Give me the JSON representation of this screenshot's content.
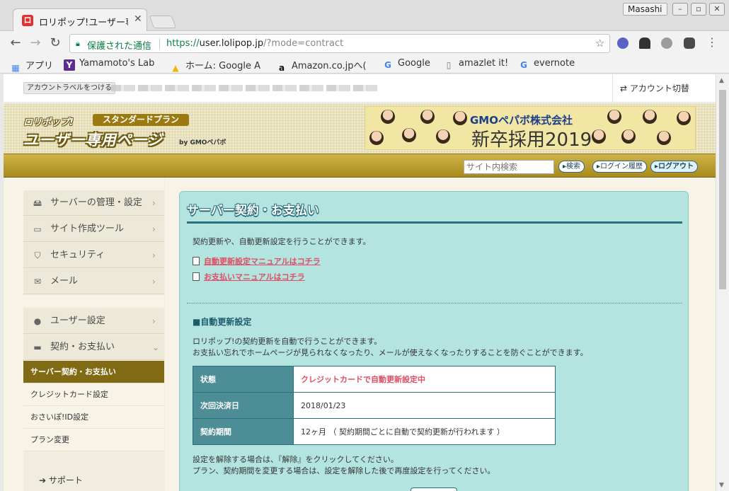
{
  "browser": {
    "tab_title": "ロリポップ!ユーザー専用ページ",
    "profile_name": "Masashi",
    "secure_label": "保護された通信",
    "url_scheme": "https://",
    "url_host": "user.lolipop.jp",
    "url_path": "/?mode=contract",
    "bookmarks": [
      {
        "label": "アプリ",
        "icon": "apps-grid-icon"
      },
      {
        "label": "Yamamoto's Lab",
        "icon": "yahoo-y-icon"
      },
      {
        "label": "ホーム: Google A",
        "icon": "google-drive-icon"
      },
      {
        "label": "Amazon.co.jpへ(",
        "icon": "amazon-icon"
      },
      {
        "label": "Google",
        "icon": "google-g-icon"
      },
      {
        "label": "amazlet it!",
        "icon": "page-icon"
      },
      {
        "label": "evernote",
        "icon": "google-g-icon"
      }
    ]
  },
  "account_bar": {
    "label_button": "アカウントラベルをつける",
    "switch_label": "アカウント切替"
  },
  "header": {
    "logo_top": "ロリポップ!",
    "plan_badge": "スタンダードプラン",
    "logo_main": "ユーザー専用ページ",
    "logo_by": "by GMOペパボ",
    "banner_company": "GMOペパボ株式会社",
    "banner_recruit": "新卒採用2019"
  },
  "nav": {
    "search_placeholder": "サイト内検索",
    "search_button": "▸検索",
    "login_history": "▸ログイン履歴",
    "logout": "▸ログアウト"
  },
  "sidebar": {
    "groups": [
      {
        "label": "サーバーの管理・設定",
        "icon": "server-icon"
      },
      {
        "label": "サイト作成ツール",
        "icon": "laptop-icon"
      },
      {
        "label": "セキュリティ",
        "icon": "shield-icon"
      },
      {
        "label": "メール",
        "icon": "envelope-icon"
      },
      {
        "label": "ユーザー設定",
        "icon": "user-icon"
      },
      {
        "label": "契約・お支払い",
        "icon": "credit-card-icon"
      }
    ],
    "sub_items": [
      {
        "label": "サーバー契約・お支払い",
        "active": true
      },
      {
        "label": "クレジットカード設定",
        "active": false
      },
      {
        "label": "おさいぽ!ID設定",
        "active": false
      },
      {
        "label": "プラン変更",
        "active": false
      }
    ],
    "support": "サポート"
  },
  "content": {
    "title": "サーバー契約・お支払い",
    "intro": "契約更新や、自動更新設定を行うことができます。",
    "manual_links": [
      "自動更新設定マニュアルはコチラ",
      "お支払いマニュアルはコチラ"
    ],
    "section_heading": "■自動更新設定",
    "section_desc_1": "ロリポップ!の契約更新を自動で行うことができます。",
    "section_desc_2": "お支払い忘れでホームページが見られなくなったり、メールが使えなくなったりすることを防ぐことができます。",
    "table": [
      {
        "label": "状態",
        "value": "クレジットカードで自動更新設定中",
        "highlight": true
      },
      {
        "label": "次回決済日",
        "value": "2018/01/23",
        "highlight": false
      },
      {
        "label": "契約期間",
        "value": "12ヶ月 （ 契約期間ごとに自動で契約更新が行われます ）",
        "highlight": false
      }
    ],
    "note_1": "設定を解除する場合は、『解除』をクリックしてください。",
    "note_2": "プラン、契約期間を変更する場合は、設定を解除した後で再度設定を行ってください。"
  },
  "colors": {
    "accent_gold": "#a88a1c",
    "sidebar_active": "#806a14",
    "panel_bg": "#b4e4e0",
    "link_red": "#e04c63"
  }
}
